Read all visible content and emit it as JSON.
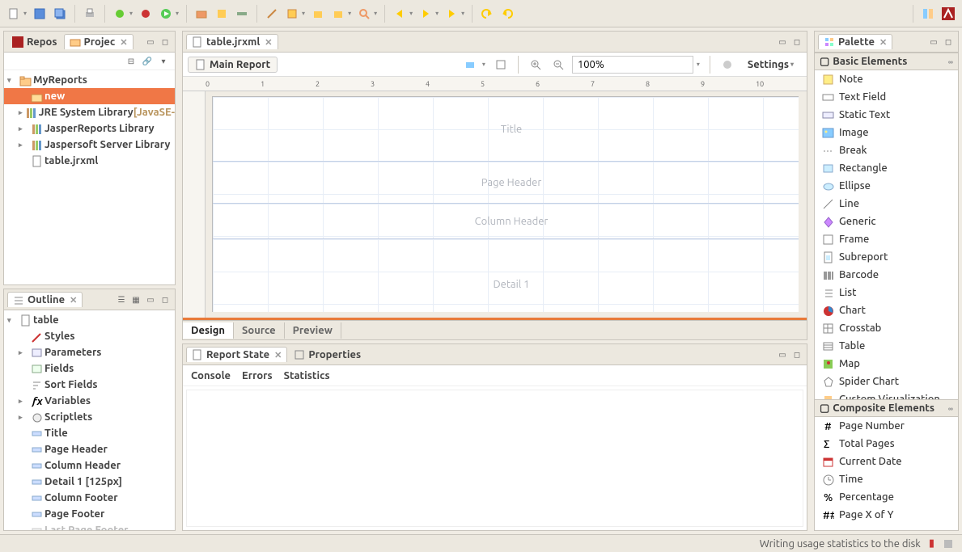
{
  "toolbar_icons": [
    "new-file",
    "save",
    "save-all",
    "print",
    "bug-green",
    "bug-red",
    "run",
    "ext-tool",
    "ext-tool-2",
    "paint",
    "toggle",
    "wand",
    "wizard",
    "wizard-alt",
    "search",
    "nav-back",
    "nav-fwd",
    "nav-fwd-2",
    "undo",
    "redo"
  ],
  "toolbar_right_icons": [
    "perspective",
    "app-logo"
  ],
  "left": {
    "view1": {
      "tabs": [
        {
          "label": "Repos",
          "active": false,
          "icon": "repo-icon"
        },
        {
          "label": "Projec",
          "active": true,
          "icon": "project-icon"
        }
      ],
      "toolbar_icons": [
        "collapse-all",
        "link",
        "menu"
      ],
      "tree": [
        {
          "lvl": 0,
          "expander": "▾",
          "icon": "project-folder-icon",
          "label": "MyReports",
          "sel": false
        },
        {
          "lvl": 1,
          "expander": "",
          "icon": "folder-open-icon",
          "label": "new",
          "sel": true
        },
        {
          "lvl": 1,
          "expander": "▸",
          "icon": "library-icon",
          "label": "JRE System Library",
          "extra": "[JavaSE-",
          "sel": false
        },
        {
          "lvl": 1,
          "expander": "▸",
          "icon": "library-icon",
          "label": "JasperReports Library",
          "sel": false
        },
        {
          "lvl": 1,
          "expander": "▸",
          "icon": "library-icon",
          "label": "Jaspersoft Server Library",
          "sel": false
        },
        {
          "lvl": 1,
          "expander": "",
          "icon": "report-file-icon",
          "label": "table.jrxml",
          "sel": false
        }
      ]
    },
    "view2": {
      "tab": {
        "label": "Outline",
        "icon": "outline-icon"
      },
      "toolbar_icons": [
        "tree-mode",
        "flat-mode",
        "minimize",
        "maximize"
      ],
      "tree": [
        {
          "lvl": 0,
          "expander": "▾",
          "icon": "report-icon",
          "label": "table"
        },
        {
          "lvl": 1,
          "expander": "",
          "icon": "styles-icon",
          "label": "Styles"
        },
        {
          "lvl": 1,
          "expander": "▸",
          "icon": "params-icon",
          "label": "Parameters"
        },
        {
          "lvl": 1,
          "expander": "",
          "icon": "fields-icon",
          "label": "Fields"
        },
        {
          "lvl": 1,
          "expander": "",
          "icon": "sort-icon",
          "label": "Sort Fields"
        },
        {
          "lvl": 1,
          "expander": "▸",
          "icon": "variables-icon",
          "label": "Variables"
        },
        {
          "lvl": 1,
          "expander": "▸",
          "icon": "scriptlets-icon",
          "label": "Scriptlets"
        },
        {
          "lvl": 1,
          "expander": "",
          "icon": "band-icon",
          "label": "Title"
        },
        {
          "lvl": 1,
          "expander": "",
          "icon": "band-icon",
          "label": "Page Header"
        },
        {
          "lvl": 1,
          "expander": "",
          "icon": "band-icon",
          "label": "Column Header"
        },
        {
          "lvl": 1,
          "expander": "",
          "icon": "band-icon",
          "label": "Detail 1 [125px]"
        },
        {
          "lvl": 1,
          "expander": "",
          "icon": "band-icon",
          "label": "Column Footer"
        },
        {
          "lvl": 1,
          "expander": "",
          "icon": "band-icon",
          "label": "Page Footer"
        },
        {
          "lvl": 1,
          "expander": "",
          "icon": "band-disabled-icon",
          "label": "Last Page Footer",
          "dim": true
        }
      ]
    }
  },
  "editor": {
    "tab": "table.jrxml",
    "main_report": "Main Report",
    "zoom": "100%",
    "settings": "Settings",
    "ruler_marks": [
      "0",
      "1",
      "2",
      "3",
      "4",
      "5",
      "6",
      "7",
      "8",
      "9",
      "10",
      "1"
    ],
    "bands": {
      "title": "Title",
      "page_header": "Page Header",
      "column_header": "Column Header",
      "detail1": "Detail 1"
    },
    "tabs": [
      "Design",
      "Source",
      "Preview"
    ]
  },
  "bottom": {
    "tabs": [
      {
        "label": "Report State",
        "active": true,
        "icon": "report-state-icon"
      },
      {
        "label": "Properties",
        "active": false,
        "icon": "properties-icon"
      }
    ],
    "subtabs": [
      "Console",
      "Errors",
      "Statistics"
    ]
  },
  "palette": {
    "title": "Palette",
    "section1": "Basic Elements",
    "basic": [
      {
        "icon": "note-icon",
        "label": "Note"
      },
      {
        "icon": "textfield-icon",
        "label": "Text Field"
      },
      {
        "icon": "statictext-icon",
        "label": "Static Text"
      },
      {
        "icon": "image-icon",
        "label": "Image"
      },
      {
        "icon": "break-icon",
        "label": "Break"
      },
      {
        "icon": "rectangle-icon",
        "label": "Rectangle"
      },
      {
        "icon": "ellipse-icon",
        "label": "Ellipse"
      },
      {
        "icon": "line-icon",
        "label": "Line"
      },
      {
        "icon": "generic-icon",
        "label": "Generic"
      },
      {
        "icon": "frame-icon",
        "label": "Frame"
      },
      {
        "icon": "subreport-icon",
        "label": "Subreport"
      },
      {
        "icon": "barcode-icon",
        "label": "Barcode"
      },
      {
        "icon": "list-icon",
        "label": "List"
      },
      {
        "icon": "chart-icon",
        "label": "Chart"
      },
      {
        "icon": "crosstab-icon",
        "label": "Crosstab"
      },
      {
        "icon": "table-icon",
        "label": "Table"
      },
      {
        "icon": "map-icon",
        "label": "Map"
      },
      {
        "icon": "spiderchart-icon",
        "label": "Spider Chart"
      },
      {
        "icon": "customviz-icon",
        "label": "Custom Visualization"
      }
    ],
    "section2": "Composite Elements",
    "composite": [
      {
        "icon": "pagenum-icon",
        "label": "Page Number"
      },
      {
        "icon": "totalpages-icon",
        "label": "Total Pages"
      },
      {
        "icon": "date-icon",
        "label": "Current Date"
      },
      {
        "icon": "time-icon",
        "label": "Time"
      },
      {
        "icon": "percentage-icon",
        "label": "Percentage"
      },
      {
        "icon": "pagexofy-icon",
        "label": "Page X of Y"
      }
    ]
  },
  "status": {
    "msg": "Writing usage statistics to the disk",
    "icons": [
      "stop-icon",
      "build-icon"
    ]
  }
}
